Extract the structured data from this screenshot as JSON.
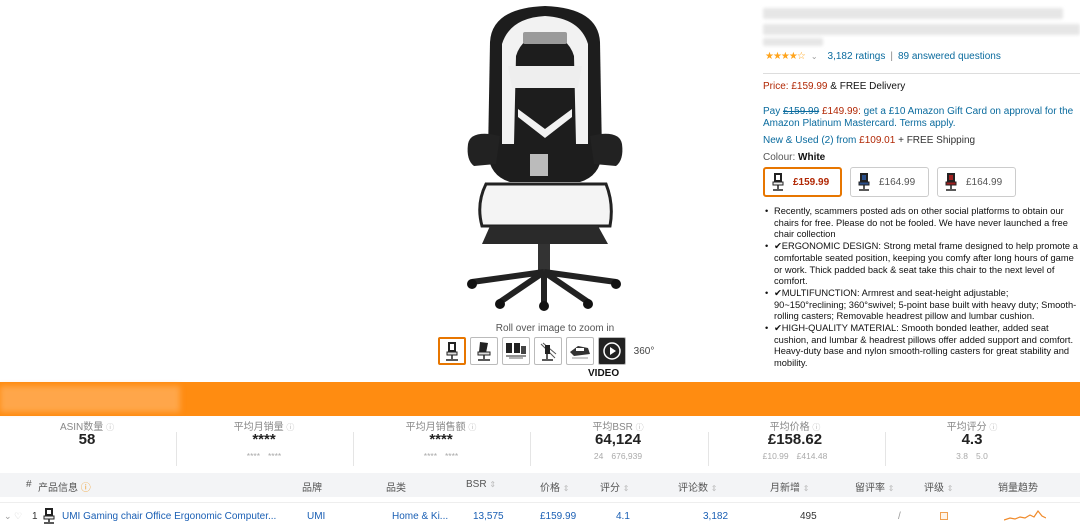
{
  "gallery": {
    "zoom_hint": "Roll over image to zoom in",
    "spin_label": "360°",
    "video_label": "VIDEO",
    "thumbnail_count": 7
  },
  "buybox": {
    "rating_value": 4,
    "stars_text": "★★★★☆",
    "ratings_count": "3,182 ratings",
    "separator": "|",
    "answered": "89 answered questions",
    "price_label": "Price:",
    "price": "£159.99",
    "delivery": "& FREE Delivery",
    "pay_prefix": "Pay",
    "pay_old": "£159.99",
    "pay_new": "£149.99:",
    "pay_rest": "get a £10 Amazon Gift Card on approval for the Amazon Platinum Mastercard.",
    "terms": "Terms apply.",
    "used_link": "New & Used (2) from",
    "used_price": "£109.01",
    "used_shipping": "+ FREE Shipping",
    "colour_label": "Colour:",
    "colour_value": "White",
    "swatches": [
      {
        "price": "£159.99",
        "accent": "#ffffff"
      },
      {
        "price": "£164.99",
        "accent": "#2a4f8a"
      },
      {
        "price": "£164.99",
        "accent": "#a02020"
      }
    ],
    "bullets": [
      "Recently, scammers posted ads on other social platforms to obtain our chairs for free. Please do not be fooled. We have never launched a free chair collection",
      "✔ERGONOMIC DESIGN: Strong metal frame designed to help promote a comfortable seated position, keeping you comfy after long hours of game or work. Thick padded back & seat take this chair to the next level of comfort.",
      "✔MULTIFUNCTION: Armrest and seat-height adjustable; 90~150°reclining; 360°swivel; 5-point base built with heavy duty; Smooth-rolling casters; Removable headrest pillow and lumbar cushion.",
      "✔HIGH-QUALITY MATERIAL: Smooth bonded leather, added seat cushion, and lumbar & headrest pillows offer added support and comfort. Heavy-duty base and nylon smooth-rolling casters for great stability and mobility."
    ]
  },
  "stats": [
    {
      "label": "ASIN数量",
      "value": "58",
      "sub": []
    },
    {
      "label": "平均月销量",
      "value": "****",
      "sub": [
        "****",
        "****"
      ]
    },
    {
      "label": "平均月销售额",
      "value": "****",
      "sub": [
        "****",
        "****"
      ]
    },
    {
      "label": "平均BSR",
      "value": "64,124",
      "sub": [
        "24",
        "676,939"
      ]
    },
    {
      "label": "平均价格",
      "value": "£158.62",
      "sub": [
        "£10.99",
        "£414.48"
      ]
    },
    {
      "label": "平均评分",
      "value": "4.3",
      "sub": [
        "3.8",
        "5.0"
      ]
    }
  ],
  "table": {
    "headers": {
      "num": "#",
      "product": "产品信息",
      "brand": "品牌",
      "category": "品类",
      "bsr": "BSR",
      "price": "价格",
      "rating": "评分",
      "reviews": "评论数",
      "monthly_new": "月新增",
      "review_rate": "留评率",
      "grade": "评级",
      "trend": "销量趋势"
    },
    "row": {
      "index": "1",
      "product": "UMI Gaming chair Office Ergonomic Computer...",
      "brand": "UMI",
      "category": "Home & Ki...",
      "bsr": "13,575",
      "price": "£159.99",
      "rating": "4.1",
      "reviews": "3,182",
      "monthly_new": "495",
      "review_rate": "/"
    }
  },
  "colors": {
    "accent": "#ff8c11",
    "link": "#0a6b9e",
    "price_red": "#b12704",
    "selected_border": "#e77600"
  }
}
